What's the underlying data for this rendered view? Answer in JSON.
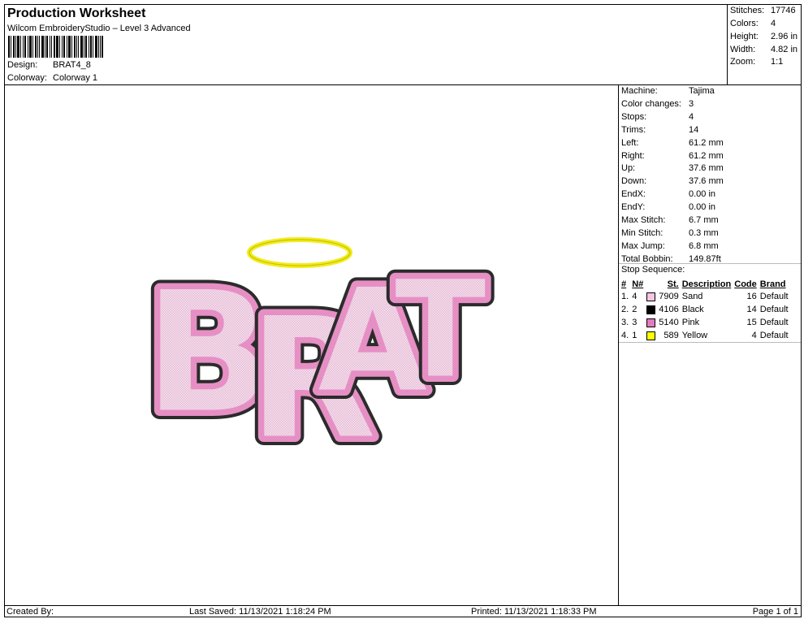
{
  "header": {
    "title": "Production Worksheet",
    "software": "Wilcom EmbroideryStudio – Level 3 Advanced",
    "design_label": "Design:",
    "design_value": "BRAT4_8",
    "colorway_label": "Colorway:",
    "colorway_value": "Colorway 1"
  },
  "summary": {
    "stitches_label": "Stitches:",
    "stitches_value": "17746",
    "colors_label": "Colors:",
    "colors_value": "4",
    "height_label": "Height:",
    "height_value": "2.96 in",
    "width_label": "Width:",
    "width_value": "4.82 in",
    "zoom_label": "Zoom:",
    "zoom_value": "1:1"
  },
  "machine_info": [
    {
      "label": "Machine:",
      "value": "Tajima"
    },
    {
      "label": "Color changes:",
      "value": "3"
    },
    {
      "label": "Stops:",
      "value": "4"
    },
    {
      "label": "Trims:",
      "value": "14"
    },
    {
      "label": "Left:",
      "value": "61.2 mm"
    },
    {
      "label": "Right:",
      "value": "61.2 mm"
    },
    {
      "label": "Up:",
      "value": "37.6 mm"
    },
    {
      "label": "Down:",
      "value": "37.6 mm"
    },
    {
      "label": "EndX:",
      "value": "0.00 in"
    },
    {
      "label": "EndY:",
      "value": "0.00 in"
    },
    {
      "label": "Max Stitch:",
      "value": "6.7 mm"
    },
    {
      "label": "Min Stitch:",
      "value": "0.3 mm"
    },
    {
      "label": "Max Jump:",
      "value": "6.8 mm"
    },
    {
      "label": "Total Bobbin:",
      "value": "149.87ft"
    }
  ],
  "stop_sequence": {
    "title": "Stop Sequence:",
    "columns": [
      "#",
      "N#",
      "St.",
      "Description",
      "Code",
      "Brand"
    ],
    "rows": [
      {
        "num": "1.",
        "n": "4",
        "color": "#f4c6e2",
        "st": "7909",
        "desc": "Sand",
        "code": "16",
        "brand": "Default"
      },
      {
        "num": "2.",
        "n": "2",
        "color": "#000000",
        "st": "4106",
        "desc": "Black",
        "code": "14",
        "brand": "Default"
      },
      {
        "num": "3.",
        "n": "3",
        "color": "#e47ac0",
        "st": "5140",
        "desc": "Pink",
        "code": "15",
        "brand": "Default"
      },
      {
        "num": "4.",
        "n": "1",
        "color": "#ffff00",
        "st": "589",
        "desc": "Yellow",
        "code": "4",
        "brand": "Default"
      }
    ]
  },
  "design": {
    "text": "BRAT",
    "colors": {
      "outline": "#2b2b2b",
      "border": "#e68fc4",
      "fill": "#f6dcec",
      "halo": "#f2ec1a"
    }
  },
  "footer": {
    "created": "Created By:",
    "saved": "Last Saved: 11/13/2021 1:18:24 PM",
    "printed": "Printed: 11/13/2021 1:18:33 PM",
    "page": "Page 1 of 1"
  }
}
